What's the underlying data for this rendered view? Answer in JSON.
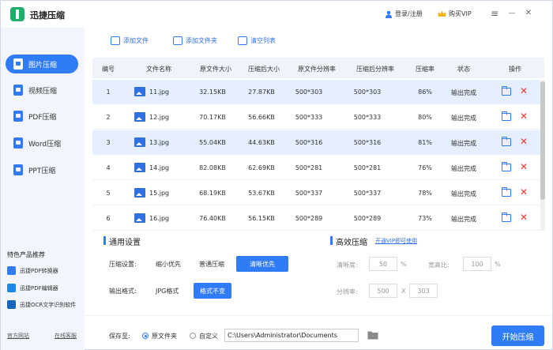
{
  "app": {
    "title": "迅捷压缩",
    "login": "登录/注册",
    "vip": "购买VIP",
    "menu_icon": "≡",
    "minimize_icon": "—",
    "close_icon": "✕"
  },
  "sidebar": {
    "items": [
      {
        "label": "图片压缩",
        "icon": "image-compress-icon",
        "active": true
      },
      {
        "label": "视频压缩",
        "icon": "video-compress-icon",
        "active": false
      },
      {
        "label": "PDF压缩",
        "icon": "pdf-compress-icon",
        "active": false
      },
      {
        "label": "Word压缩",
        "icon": "word-compress-icon",
        "active": false
      },
      {
        "label": "PPT压缩",
        "icon": "ppt-compress-icon",
        "active": false
      }
    ],
    "featured_title": "特色产品推荐",
    "featured": [
      {
        "label": "迅捷PDF转换器",
        "color": "#2f7cf6"
      },
      {
        "label": "迅捷PDF编辑器",
        "color": "#1e88e5"
      },
      {
        "label": "迅捷OCR文字识别软件",
        "color": "#1565c0"
      }
    ],
    "website": "官方网站",
    "support": "在线客服"
  },
  "toolbar": {
    "add_file": "添加文件",
    "add_folder": "添加文件夹",
    "clear_list": "清空列表"
  },
  "table": {
    "headers": [
      "编号",
      "文件名称",
      "原文件大小",
      "压缩后大小",
      "原文件分辨率",
      "压缩后分辨率",
      "压缩率",
      "状态",
      "操作"
    ],
    "rows": [
      {
        "id": "1",
        "name": "11.jpg",
        "orig_size": "32.15KB",
        "comp_size": "27.87KB",
        "orig_res": "500*303",
        "comp_res": "500*303",
        "rate": "86%",
        "status": "输出完成",
        "selected": true
      },
      {
        "id": "2",
        "name": "12.jpg",
        "orig_size": "70.17KB",
        "comp_size": "56.66KB",
        "orig_res": "500*333",
        "comp_res": "500*333",
        "rate": "80%",
        "status": "输出完成",
        "selected": false
      },
      {
        "id": "3",
        "name": "13.jpg",
        "orig_size": "55.04KB",
        "comp_size": "44.63KB",
        "orig_res": "500*316",
        "comp_res": "500*316",
        "rate": "81%",
        "status": "输出完成",
        "selected": true
      },
      {
        "id": "4",
        "name": "14.jpg",
        "orig_size": "82.08KB",
        "comp_size": "62.69KB",
        "orig_res": "500*281",
        "comp_res": "500*281",
        "rate": "76%",
        "status": "输出完成",
        "selected": false
      },
      {
        "id": "5",
        "name": "15.jpg",
        "orig_size": "68.19KB",
        "comp_size": "53.67KB",
        "orig_res": "500*337",
        "comp_res": "500*337",
        "rate": "78%",
        "status": "输出完成",
        "selected": false
      },
      {
        "id": "6",
        "name": "16.jpg",
        "orig_size": "76.40KB",
        "comp_size": "56.15KB",
        "orig_res": "500*289",
        "comp_res": "500*289",
        "rate": "73%",
        "status": "输出完成",
        "selected": false
      }
    ]
  },
  "general": {
    "title": "通用设置",
    "compress_label": "压缩设置:",
    "compress_options": [
      "缩小优先",
      "普通压缩",
      "清晰优先"
    ],
    "compress_selected": "清晰优先",
    "output_label": "输出格式:",
    "output_options": [
      "JPG格式",
      "格式不变"
    ],
    "output_selected": "格式不变"
  },
  "advanced": {
    "title": "高效压缩",
    "vip_link": "开通VIP即可使用",
    "clarity_label": "清晰度:",
    "clarity_value": "50",
    "clarity_unit": "%",
    "ratio_label": "宽高比:",
    "ratio_value": "100",
    "ratio_unit": "%",
    "resolution_label": "分辨率:",
    "width_value": "500",
    "times": "X",
    "height_value": "303"
  },
  "bottom": {
    "save_label": "保存至:",
    "opt_original": "原文件夹",
    "opt_custom": "自定义",
    "path": "C:\\Users\\Administrator\\Documents",
    "start": "开始压缩"
  }
}
